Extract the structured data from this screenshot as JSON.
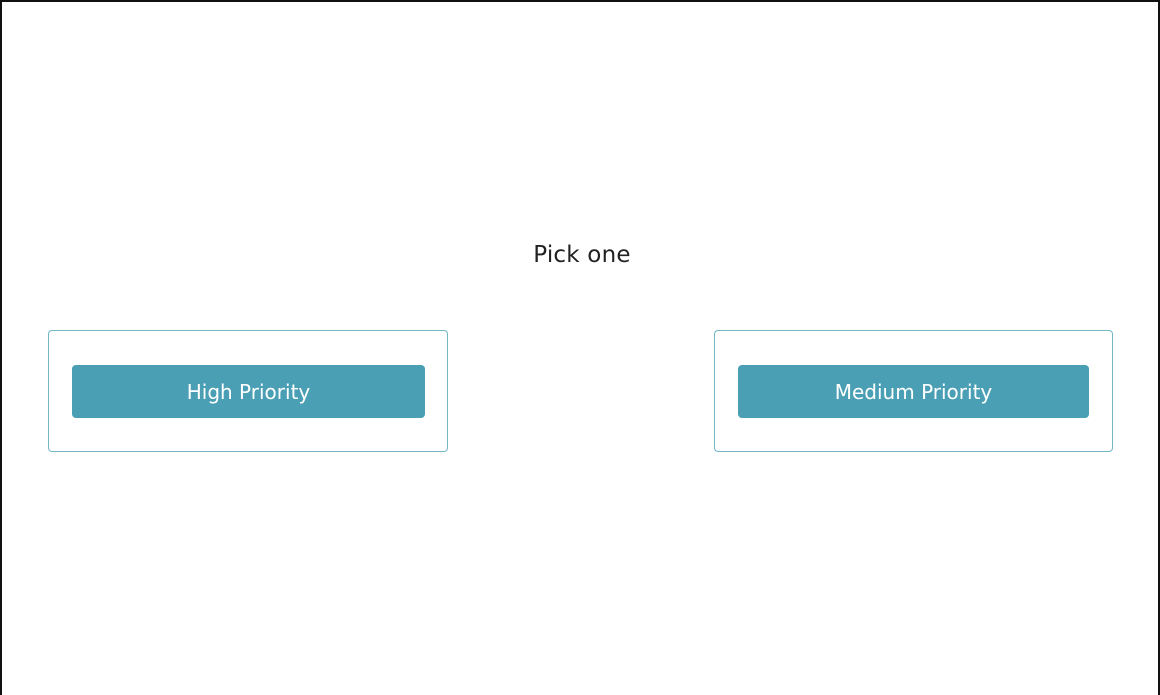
{
  "prompt": "Pick one",
  "choices": [
    {
      "label": "High Priority"
    },
    {
      "label": "Medium Priority"
    }
  ],
  "colors": {
    "button": "#4a9fb5",
    "card_border": "#6fb6c7",
    "text": "#222222",
    "background": "#ffffff"
  }
}
